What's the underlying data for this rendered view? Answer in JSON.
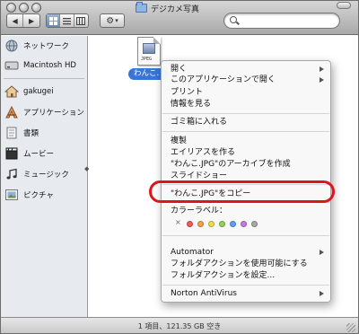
{
  "window": {
    "title": "デジカメ写真"
  },
  "toolbar": {
    "back_glyph": "◀",
    "forward_glyph": "▶",
    "gear_glyph": "⚙",
    "dropdown_glyph": "▾",
    "views": [
      "icon-view",
      "list-view",
      "column-view"
    ],
    "active_view": "icon-view",
    "search_value": ""
  },
  "sidebar": {
    "items": [
      {
        "label": "ネットワーク",
        "icon": "network-globe-icon"
      },
      {
        "label": "Macintosh HD",
        "icon": "hard-drive-icon"
      },
      {
        "label": "gakugei",
        "icon": "home-icon"
      },
      {
        "label": "アプリケーション",
        "icon": "applications-icon"
      },
      {
        "label": "書類",
        "icon": "documents-icon"
      },
      {
        "label": "ムービー",
        "icon": "movies-icon"
      },
      {
        "label": "ミュージック",
        "icon": "music-icon"
      },
      {
        "label": "ピクチャ",
        "icon": "pictures-icon"
      }
    ]
  },
  "file": {
    "name": "わんこ.JPG",
    "label_visible": "わんこ.",
    "badge": "JPEG"
  },
  "context_menu": {
    "items": [
      {
        "label": "開く",
        "submenu": true
      },
      {
        "label": "このアプリケーションで開く",
        "submenu": true
      },
      {
        "label": "プリント",
        "submenu": false
      },
      {
        "label": "情報を見る",
        "submenu": false
      },
      {
        "label": "ゴミ箱に入れる",
        "submenu": false
      },
      {
        "label": "複製",
        "submenu": false
      },
      {
        "label": "エイリアスを作る",
        "submenu": false
      },
      {
        "label": "\"わんこ.JPG\"のアーカイブを作成",
        "submenu": false
      },
      {
        "label": "スライドショー",
        "submenu": false
      },
      {
        "label": "\"わんこ.JPG\"をコピー",
        "submenu": false,
        "highlighted": true
      },
      {
        "label": "カラーラベル：",
        "submenu": false
      },
      {
        "label": "Automator",
        "submenu": true
      },
      {
        "label": "フォルダアクションを使用可能にする",
        "submenu": false
      },
      {
        "label": "フォルダアクションを設定...",
        "submenu": false
      },
      {
        "label": "Norton AntiVirus",
        "submenu": true
      }
    ],
    "label_none_glyph": "×",
    "label_colors": [
      "#ef5c5c",
      "#f0a34a",
      "#f2dc4a",
      "#93d25b",
      "#5da0ef",
      "#c27be0",
      "#a9a9a9"
    ]
  },
  "highlight_color": "#e0141b",
  "status": {
    "text": "1 項目、121.35 GB 空き"
  }
}
